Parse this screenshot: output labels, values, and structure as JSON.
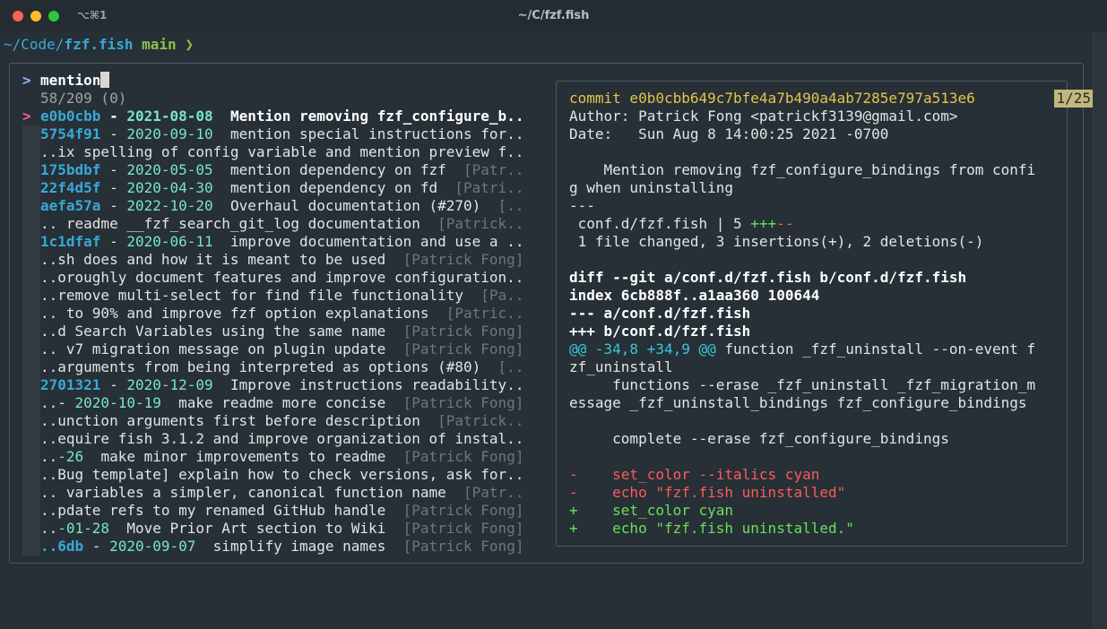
{
  "window": {
    "title": "~/C/fzf.fish",
    "shortcut": "⌥⌘1",
    "colors": {
      "close": "#fe5f57",
      "minimize": "#febc2e",
      "zoom": "#28c840"
    }
  },
  "prompt": {
    "path_prefix": "~/Code/",
    "repo": "fzf.fish",
    "branch": "main",
    "caret": "❯"
  },
  "fzf": {
    "query_caret": ">",
    "query": "mention",
    "match_count": "58/209 (0)",
    "selected_caret": ">",
    "rows": [
      {
        "hash": "e0b0cbb",
        "sep": " - ",
        "date": "2021-08-08",
        "msg": "  Mention removing fzf_configure_b..",
        "author": "",
        "selected": true
      },
      {
        "hash": "5754f91",
        "sep": " - ",
        "date": "2020-09-10",
        "msg": "  mention special instructions for..",
        "author": ""
      },
      {
        "hash": "",
        "sep": "",
        "date": "",
        "msg": "..ix spelling of config variable and mention preview f..",
        "author": ""
      },
      {
        "hash": "175bdbf",
        "sep": " - ",
        "date": "2020-05-05",
        "msg": "  mention dependency on fzf  ",
        "author": "[Patr.."
      },
      {
        "hash": "22f4d5f",
        "sep": " - ",
        "date": "2020-04-30",
        "msg": "  mention dependency on fd  ",
        "author": "[Patri.."
      },
      {
        "hash": "aefa57a",
        "sep": " - ",
        "date": "2022-10-20",
        "msg": "  Overhaul documentation (#270)  ",
        "author": "[.."
      },
      {
        "hash": "",
        "sep": "",
        "date": "",
        "msg": ".. readme __fzf_search_git_log documentation  ",
        "author": "[Patrick.."
      },
      {
        "hash": "1c1dfaf",
        "sep": " - ",
        "date": "2020-06-11",
        "msg": "  improve documentation and use a ..",
        "author": ""
      },
      {
        "hash": "",
        "sep": "",
        "date": "",
        "msg": "..sh does and how it is meant to be used  ",
        "author": "[Patrick Fong]"
      },
      {
        "hash": "",
        "sep": "",
        "date": "",
        "msg": "..oroughly document features and improve configuration..",
        "author": ""
      },
      {
        "hash": "",
        "sep": "",
        "date": "",
        "msg": "..remove multi-select for find file functionality  ",
        "author": "[Pa.."
      },
      {
        "hash": "",
        "sep": "",
        "date": "",
        "msg": ".. to 90% and improve fzf option explanations  ",
        "author": "[Patric.."
      },
      {
        "hash": "",
        "sep": "",
        "date": "",
        "msg": "..d Search Variables using the same name  ",
        "author": "[Patrick Fong]"
      },
      {
        "hash": "",
        "sep": "",
        "date": "",
        "msg": ".. v7 migration message on plugin update  ",
        "author": "[Patrick Fong]"
      },
      {
        "hash": "",
        "sep": "",
        "date": "",
        "msg": "..arguments from being interpreted as options (#80)  ",
        "author": "[.."
      },
      {
        "hash": "2701321",
        "sep": " - ",
        "date": "2020-12-09",
        "msg": "  Improve instructions readability..",
        "author": ""
      },
      {
        "hash": "",
        "sep": "..- ",
        "date": "2020-10-19",
        "msg": "  make readme more concise  ",
        "author": "[Patrick Fong]"
      },
      {
        "hash": "",
        "sep": "",
        "date": "",
        "msg": "..unction arguments first before description  ",
        "author": "[Patrick.."
      },
      {
        "hash": "",
        "sep": "",
        "date": "",
        "msg": "..equire fish 3.1.2 and improve organization of instal..",
        "author": ""
      },
      {
        "hash": "",
        "sep": "..",
        "date": "-26",
        "msg": "  make minor improvements to readme  ",
        "author": "[Patrick Fong]"
      },
      {
        "hash": "",
        "sep": "",
        "date": "",
        "msg": "..Bug template] explain how to check versions, ask for..",
        "author": ""
      },
      {
        "hash": "",
        "sep": "",
        "date": "",
        "msg": ".. variables a simpler, canonical function name  ",
        "author": "[Patr.."
      },
      {
        "hash": "",
        "sep": "",
        "date": "",
        "msg": "..pdate refs to my renamed GitHub handle  ",
        "author": "[Patrick Fong]"
      },
      {
        "hash": "",
        "sep": "..",
        "date": "-01-28",
        "msg": "  Move Prior Art section to Wiki  ",
        "author": "[Patrick Fong]"
      },
      {
        "hash": "..6db",
        "sep": " - ",
        "date": "2020-09-07",
        "msg": "  simplify image names  ",
        "author": "[Patrick Fong]"
      }
    ]
  },
  "preview": {
    "position": "1/25",
    "lines": [
      {
        "t": "commit e0b0cbb649c7bfe4a7b490a4ab7285e797a513e6",
        "k": "commit"
      },
      {
        "t": "Author: Patrick Fong <patrickf3139@gmail.com>",
        "k": "plain"
      },
      {
        "t": "Date:   Sun Aug 8 14:00:25 2021 -0700",
        "k": "plain"
      },
      {
        "t": "",
        "k": "plain"
      },
      {
        "t": "    Mention removing fzf_configure_bindings from confi",
        "k": "plain"
      },
      {
        "t": "g when uninstalling",
        "k": "plain"
      },
      {
        "t": "---",
        "k": "plain"
      },
      {
        "t": " conf.d/fzf.fish | 5 ",
        "k": "stat",
        "plus": "+++",
        "minus": "--"
      },
      {
        "t": " 1 file changed, 3 insertions(+), 2 deletions(-)",
        "k": "plain"
      },
      {
        "t": "",
        "k": "plain"
      },
      {
        "t": "diff --git a/conf.d/fzf.fish b/conf.d/fzf.fish",
        "k": "bold"
      },
      {
        "t": "index 6cb888f..a1aa360 100644",
        "k": "bold"
      },
      {
        "t": "--- a/conf.d/fzf.fish",
        "k": "bold"
      },
      {
        "t": "+++ b/conf.d/fzf.fish",
        "k": "bold"
      },
      {
        "t": "@@ -34,8 +34,9 @@",
        "k": "hunk",
        "rest": " function _fzf_uninstall --on-event f"
      },
      {
        "t": "zf_uninstall",
        "k": "plain"
      },
      {
        "t": "     functions --erase _fzf_uninstall _fzf_migration_m",
        "k": "plain"
      },
      {
        "t": "essage _fzf_uninstall_bindings fzf_configure_bindings",
        "k": "plain"
      },
      {
        "t": "",
        "k": "plain"
      },
      {
        "t": "     complete --erase fzf_configure_bindings",
        "k": "plain"
      },
      {
        "t": "",
        "k": "plain"
      },
      {
        "t": "-    set_color --italics cyan",
        "k": "minus"
      },
      {
        "t": "-    echo \"fzf.fish uninstalled\"",
        "k": "minus"
      },
      {
        "t": "+    set_color cyan",
        "k": "plus"
      },
      {
        "t": "+    echo \"fzf.fish uninstalled.\"",
        "k": "plus"
      }
    ]
  }
}
